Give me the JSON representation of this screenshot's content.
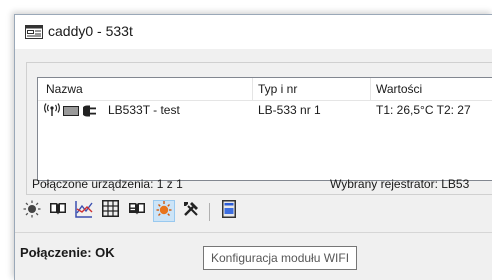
{
  "window": {
    "title": "caddy0 - 533t"
  },
  "device_list": {
    "columns": [
      "Nazwa",
      "Typ i nr",
      "Wartości"
    ],
    "rows": [
      {
        "name": "LB533T - test",
        "type": "LB-533 nr 1",
        "values": "T1: 26,5°C  T2: 27"
      }
    ]
  },
  "status": {
    "connected_devices": "Połączone urządzenia: 1 z 1",
    "selected_recorder": "Wybrany rejestrator: LB53"
  },
  "toolbar": {
    "buttons": [
      {
        "icon": "sun-icon"
      },
      {
        "icon": "book-icon"
      },
      {
        "icon": "chart-icon"
      },
      {
        "icon": "table-icon"
      },
      {
        "icon": "open-book-icon"
      },
      {
        "icon": "wifi-config-icon",
        "active": true
      },
      {
        "icon": "tools-icon"
      },
      {
        "icon": "device-panel-icon"
      }
    ]
  },
  "connection": {
    "label": "Połączenie: OK"
  },
  "tooltip": {
    "text": "Konfiguracja modułu WIFI"
  },
  "colors": {
    "accent_active": "#cce4f7",
    "window_bg": "#f0f0f0"
  }
}
